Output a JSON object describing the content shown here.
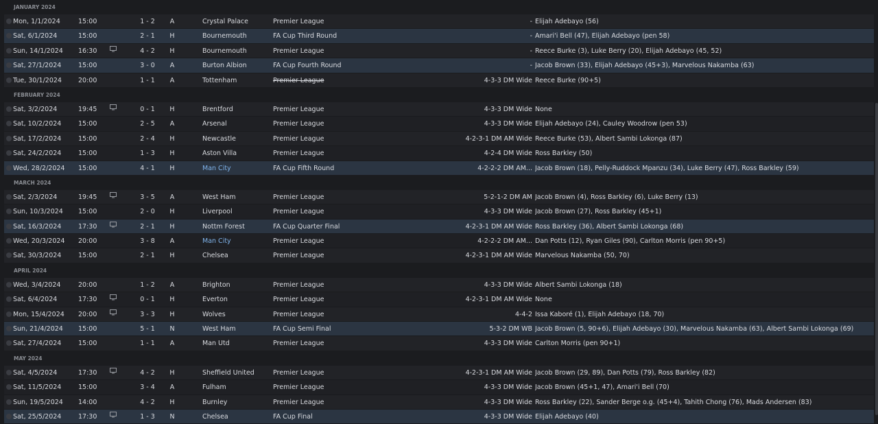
{
  "sections": [
    {
      "month": "JANUARY 2024",
      "fixtures": [
        {
          "date": "Mon, 1/1/2024",
          "time": "15:00",
          "tv": false,
          "result": "L",
          "score": "1 - 2",
          "venue": "A",
          "opponent": "Crystal Palace",
          "crest_color": "#2b4ea2",
          "competition": "Premier League",
          "formation": "-",
          "scorers": "Elijah Adebayo (56)",
          "highlight": false,
          "opponent_link": false
        },
        {
          "date": "Sat, 6/1/2024",
          "time": "15:00",
          "tv": false,
          "result": "L",
          "score": "2 - 1",
          "venue": "H",
          "opponent": "Bournemouth",
          "crest_color": "#c8102e",
          "competition": "FA Cup Third Round",
          "formation": "-",
          "scorers": "Amari'i Bell (47), Elijah Adebayo (pen 58)",
          "highlight": true,
          "opponent_link": false
        },
        {
          "date": "Sun, 14/1/2024",
          "time": "16:30",
          "tv": true,
          "result": "W",
          "score": "4 - 2",
          "venue": "H",
          "opponent": "Bournemouth",
          "crest_color": "#c8102e",
          "competition": "Premier League",
          "formation": "-",
          "scorers": "Reece Burke (3), Luke Berry (20), Elijah Adebayo (45, 52)",
          "highlight": false,
          "opponent_link": false
        },
        {
          "date": "Sat, 27/1/2024",
          "time": "15:00",
          "tv": false,
          "result": "W",
          "score": "3 - 0",
          "venue": "A",
          "opponent": "Burton Albion",
          "crest_color": "#e8c813",
          "competition": "FA Cup Fourth Round",
          "formation": "-",
          "scorers": "Jacob Brown (33), Elijah Adebayo (45+3), Marvelous Nakamba (63)",
          "highlight": true,
          "opponent_link": false
        },
        {
          "date": "Tue, 30/1/2024",
          "time": "20:00",
          "tv": false,
          "result": "D",
          "score": "1 - 1",
          "venue": "A",
          "opponent": "Tottenham",
          "crest_color": "#1a2a5a",
          "competition": "Premier League",
          "formation": "4-3-3 DM Wide",
          "scorers": "Reece Burke (90+5)",
          "highlight": false,
          "opponent_link": false,
          "strike": true
        }
      ]
    },
    {
      "month": "FEBRUARY 2024",
      "fixtures": [
        {
          "date": "Sat, 3/2/2024",
          "time": "19:45",
          "tv": true,
          "result": "L",
          "score": "0 - 1",
          "venue": "H",
          "opponent": "Brentford",
          "crest_color": "#d2232a",
          "competition": "Premier League",
          "formation": "4-3-3 DM Wide",
          "scorers": "None",
          "highlight": false,
          "opponent_link": false
        },
        {
          "date": "Sat, 10/2/2024",
          "time": "15:00",
          "tv": false,
          "result": "L",
          "score": "2 - 5",
          "venue": "A",
          "opponent": "Arsenal",
          "crest_color": "#ef0107",
          "competition": "Premier League",
          "formation": "4-3-3 DM Wide",
          "scorers": "Elijah Adebayo (24), Cauley Woodrow (pen 53)",
          "highlight": false,
          "opponent_link": false
        },
        {
          "date": "Sat, 17/2/2024",
          "time": "15:00",
          "tv": false,
          "result": "L",
          "score": "2 - 4",
          "venue": "H",
          "opponent": "Newcastle",
          "crest_color": "#9a9a9a",
          "competition": "Premier League",
          "formation": "4-2-3-1 DM AM Wide",
          "scorers": "Reece Burke (53), Albert Sambi Lokonga (87)",
          "highlight": false,
          "opponent_link": false
        },
        {
          "date": "Sat, 24/2/2024",
          "time": "15:00",
          "tv": false,
          "result": "L",
          "score": "1 - 3",
          "venue": "H",
          "opponent": "Aston Villa",
          "crest_color": "#95bfe5",
          "competition": "Premier League",
          "formation": "4-2-4 DM Wide",
          "scorers": "Ross Barkley (50)",
          "highlight": false,
          "opponent_link": false
        },
        {
          "date": "Wed, 28/2/2024",
          "time": "15:00",
          "tv": false,
          "result": "W",
          "score": "4 - 1",
          "venue": "H",
          "opponent": "Man City",
          "crest_color": "#6cabdd",
          "competition": "FA Cup Fifth Round",
          "formation": "4-2-2-2 DM AM...",
          "scorers": "Jacob Brown (18), Pelly-Ruddock Mpanzu (34), Luke Berry (47), Ross Barkley (59)",
          "highlight": true,
          "opponent_link": true
        }
      ]
    },
    {
      "month": "MARCH 2024",
      "fixtures": [
        {
          "date": "Sat, 2/3/2024",
          "time": "19:45",
          "tv": true,
          "result": "L",
          "score": "3 - 5",
          "venue": "A",
          "opponent": "West Ham",
          "crest_color": "#7a263a",
          "competition": "Premier League",
          "formation": "5-2-1-2 DM AM",
          "scorers": "Jacob Brown (4), Ross Barkley (6), Luke Berry (13)",
          "highlight": false,
          "opponent_link": false
        },
        {
          "date": "Sun, 10/3/2024",
          "time": "15:00",
          "tv": false,
          "result": "W",
          "score": "2 - 0",
          "venue": "H",
          "opponent": "Liverpool",
          "crest_color": "#c8102e",
          "competition": "Premier League",
          "formation": "4-3-3 DM Wide",
          "scorers": "Jacob Brown (27), Ross Barkley (45+1)",
          "highlight": false,
          "opponent_link": false
        },
        {
          "date": "Sat, 16/3/2024",
          "time": "17:30",
          "tv": true,
          "result": "W",
          "score": "2 - 1",
          "venue": "H",
          "opponent": "Nottm Forest",
          "crest_color": "#dd0000",
          "competition": "FA Cup Quarter Final",
          "formation": "4-2-3-1 DM AM Wide",
          "scorers": "Ross Barkley (36), Albert Sambi Lokonga (68)",
          "highlight": true,
          "opponent_link": false
        },
        {
          "date": "Wed, 20/3/2024",
          "time": "20:00",
          "tv": false,
          "result": "L",
          "score": "3 - 8",
          "venue": "A",
          "opponent": "Man City",
          "crest_color": "#6cabdd",
          "competition": "Premier League",
          "formation": "4-2-2-2 DM AM...",
          "scorers": "Dan Potts (12), Ryan Giles (90), Carlton Morris (pen 90+5)",
          "highlight": false,
          "opponent_link": true
        },
        {
          "date": "Sat, 30/3/2024",
          "time": "15:00",
          "tv": false,
          "result": "W",
          "score": "2 - 1",
          "venue": "H",
          "opponent": "Chelsea",
          "crest_color": "#034694",
          "competition": "Premier League",
          "formation": "4-2-3-1 DM AM Wide",
          "scorers": "Marvelous Nakamba (50, 70)",
          "highlight": false,
          "opponent_link": false
        }
      ]
    },
    {
      "month": "APRIL 2024",
      "fixtures": [
        {
          "date": "Wed, 3/4/2024",
          "time": "20:00",
          "tv": false,
          "result": "L",
          "score": "1 - 2",
          "venue": "A",
          "opponent": "Brighton",
          "crest_color": "#0057b8",
          "competition": "Premier League",
          "formation": "4-3-3 DM Wide",
          "scorers": "Albert Sambi Lokonga (18)",
          "highlight": false,
          "opponent_link": false
        },
        {
          "date": "Sat, 6/4/2024",
          "time": "17:30",
          "tv": true,
          "result": "L",
          "score": "0 - 1",
          "venue": "H",
          "opponent": "Everton",
          "crest_color": "#003399",
          "competition": "Premier League",
          "formation": "4-2-3-1 DM AM Wide",
          "scorers": "None",
          "highlight": false,
          "opponent_link": false
        },
        {
          "date": "Mon, 15/4/2024",
          "time": "20:00",
          "tv": true,
          "result": "D",
          "score": "3 - 3",
          "venue": "H",
          "opponent": "Wolves",
          "crest_color": "#fdb913",
          "competition": "Premier League",
          "formation": "4-4-2",
          "scorers": "Issa Kaboré (1), Elijah Adebayo (18, 70)",
          "highlight": false,
          "opponent_link": false
        },
        {
          "date": "Sun, 21/4/2024",
          "time": "15:00",
          "tv": false,
          "result": "W",
          "score": "5 - 1",
          "venue": "N",
          "opponent": "West Ham",
          "crest_color": "#7a263a",
          "competition": "FA Cup Semi Final",
          "formation": "5-3-2 DM WB",
          "scorers": "Jacob Brown (5, 90+6), Elijah Adebayo (30), Marvelous Nakamba (63), Albert Sambi Lokonga (69)",
          "highlight": true,
          "opponent_link": false
        },
        {
          "date": "Sat, 27/4/2024",
          "time": "15:00",
          "tv": false,
          "result": "D",
          "score": "1 - 1",
          "venue": "A",
          "opponent": "Man Utd",
          "crest_color": "#da291c",
          "competition": "Premier League",
          "formation": "4-3-3 DM Wide",
          "scorers": "Carlton Morris (pen 90+1)",
          "highlight": false,
          "opponent_link": false
        }
      ]
    },
    {
      "month": "MAY 2024",
      "fixtures": [
        {
          "date": "Sat, 4/5/2024",
          "time": "17:30",
          "tv": true,
          "result": "W",
          "score": "4 - 2",
          "venue": "H",
          "opponent": "Sheffield United",
          "crest_color": "#ee2737",
          "competition": "Premier League",
          "formation": "4-2-3-1 DM AM Wide",
          "scorers": "Jacob Brown (29, 89), Dan Potts (79), Ross Barkley (82)",
          "highlight": false,
          "opponent_link": false
        },
        {
          "date": "Sat, 11/5/2024",
          "time": "15:00",
          "tv": false,
          "result": "L",
          "score": "3 - 4",
          "venue": "A",
          "opponent": "Fulham",
          "crest_color": "#cccccc",
          "competition": "Premier League",
          "formation": "4-3-3 DM Wide",
          "scorers": "Jacob Brown (45+1, 47), Amari'i Bell (70)",
          "highlight": false,
          "opponent_link": false
        },
        {
          "date": "Sun, 19/5/2024",
          "time": "14:00",
          "tv": false,
          "result": "W",
          "score": "4 - 2",
          "venue": "H",
          "opponent": "Burnley",
          "crest_color": "#6c1d45",
          "competition": "Premier League",
          "formation": "4-3-3 DM Wide",
          "scorers": "Ross Barkley (22), Sander Berge o.g. (45+4), Tahith Chong (76), Mads Andersen (83)",
          "highlight": false,
          "opponent_link": false
        },
        {
          "date": "Sat, 25/5/2024",
          "time": "17:30",
          "tv": true,
          "result": "L",
          "score": "1 - 3",
          "venue": "N",
          "opponent": "Chelsea",
          "crest_color": "#034694",
          "competition": "FA Cup Final",
          "formation": "4-3-3 DM Wide",
          "scorers": "Elijah Adebayo (40)",
          "highlight": true,
          "opponent_link": false
        }
      ]
    }
  ],
  "icons": {
    "tv": "tv-icon",
    "result": "result-icon",
    "crest": "club-crest-icon"
  },
  "colors": {
    "win": "#3ec46d",
    "loss": "#e54b4b",
    "draw": "#f0b323",
    "cup_row": "#2b3542",
    "link": "#7fb3ea"
  }
}
